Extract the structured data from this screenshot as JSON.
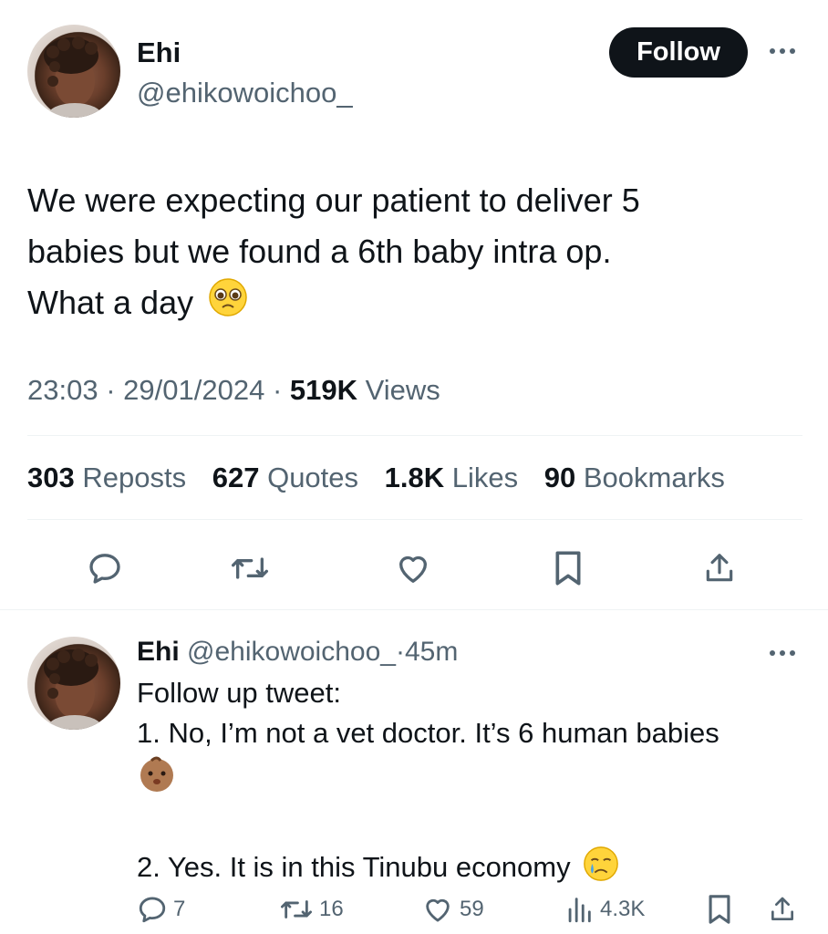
{
  "tweet": {
    "author_name": "Ehi",
    "author_handle": "@ehikowoichoo_",
    "follow_label": "Follow",
    "text_line1": "We were expecting our patient to deliver 5",
    "text_line2": "babies but we found a 6th baby intra op.",
    "text_line3": "What a day",
    "emoji_icon": "face-holding-back-tears-icon",
    "time": "23:03",
    "date": "29/01/2024",
    "separator": "·",
    "views_count": "519K",
    "views_label": "Views",
    "stats": {
      "reposts_count": "303",
      "reposts_label": "Reposts",
      "quotes_count": "627",
      "quotes_label": "Quotes",
      "likes_count": "1.8K",
      "likes_label": "Likes",
      "bookmarks_count": "90",
      "bookmarks_label": "Bookmarks"
    },
    "actions": [
      "reply-icon",
      "repost-icon",
      "like-icon",
      "bookmark-icon",
      "share-icon"
    ]
  },
  "reply": {
    "author_name": "Ehi",
    "author_handle": "@ehikowoichoo_",
    "separator": "·",
    "time": "45m",
    "line1": "Follow up tweet:",
    "line2": "1. No, I’m not a vet doctor. It’s 6 human babies",
    "line3": "2. Yes. It is in this Tinubu economy",
    "baby_emoji_icon": "baby-icon",
    "crying_emoji_icon": "crying-face-icon",
    "reply_count": "7",
    "repost_count": "16",
    "like_count": "59",
    "views_count": "4.3K"
  },
  "colors": {
    "text": "#0f1419",
    "secondary": "#536471",
    "divider": "#eff3f4",
    "button": "#0f1419"
  }
}
